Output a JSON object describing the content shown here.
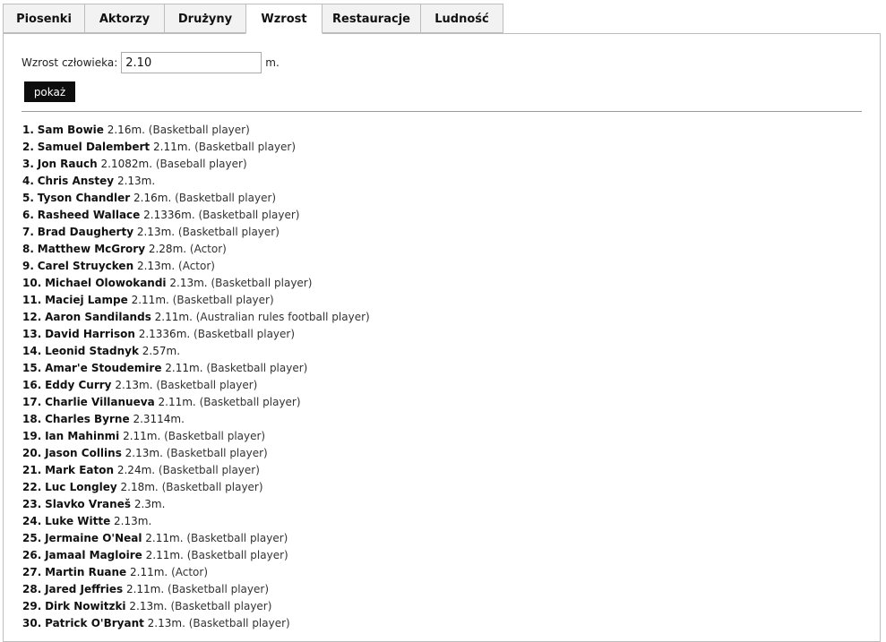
{
  "tabs": [
    {
      "label": "Piosenki",
      "active": false
    },
    {
      "label": "Aktorzy",
      "active": false
    },
    {
      "label": "Drużyny",
      "active": false
    },
    {
      "label": "Wzrost",
      "active": true
    },
    {
      "label": "Restauracje",
      "active": false
    },
    {
      "label": "Ludność",
      "active": false
    }
  ],
  "form": {
    "label": "Wzrost człowieka:",
    "value": "2.10",
    "unit": "m.",
    "button": "pokaż"
  },
  "results": [
    {
      "num": "1.",
      "name": "Sam Bowie",
      "height": "2.16m.",
      "role": "(Basketball player)"
    },
    {
      "num": "2.",
      "name": "Samuel Dalembert",
      "height": "2.11m.",
      "role": "(Basketball player)"
    },
    {
      "num": "3.",
      "name": "Jon Rauch",
      "height": "2.1082m.",
      "role": "(Baseball player)"
    },
    {
      "num": "4.",
      "name": "Chris Anstey",
      "height": "2.13m.",
      "role": ""
    },
    {
      "num": "5.",
      "name": "Tyson Chandler",
      "height": "2.16m.",
      "role": "(Basketball player)"
    },
    {
      "num": "6.",
      "name": "Rasheed Wallace",
      "height": "2.1336m.",
      "role": "(Basketball player)"
    },
    {
      "num": "7.",
      "name": "Brad Daugherty",
      "height": "2.13m.",
      "role": "(Basketball player)"
    },
    {
      "num": "8.",
      "name": "Matthew McGrory",
      "height": "2.28m.",
      "role": "(Actor)"
    },
    {
      "num": "9.",
      "name": "Carel Struycken",
      "height": "2.13m.",
      "role": "(Actor)"
    },
    {
      "num": "10.",
      "name": "Michael Olowokandi",
      "height": "2.13m.",
      "role": "(Basketball player)"
    },
    {
      "num": "11.",
      "name": "Maciej Lampe",
      "height": "2.11m.",
      "role": "(Basketball player)"
    },
    {
      "num": "12.",
      "name": "Aaron Sandilands",
      "height": "2.11m.",
      "role": "(Australian rules football player)"
    },
    {
      "num": "13.",
      "name": "David Harrison",
      "height": "2.1336m.",
      "role": "(Basketball player)"
    },
    {
      "num": "14.",
      "name": "Leonid Stadnyk",
      "height": "2.57m.",
      "role": ""
    },
    {
      "num": "15.",
      "name": "Amar'e Stoudemire",
      "height": "2.11m.",
      "role": "(Basketball player)"
    },
    {
      "num": "16.",
      "name": "Eddy Curry",
      "height": "2.13m.",
      "role": "(Basketball player)"
    },
    {
      "num": "17.",
      "name": "Charlie Villanueva",
      "height": "2.11m.",
      "role": "(Basketball player)"
    },
    {
      "num": "18.",
      "name": "Charles Byrne",
      "height": "2.3114m.",
      "role": ""
    },
    {
      "num": "19.",
      "name": "Ian Mahinmi",
      "height": "2.11m.",
      "role": "(Basketball player)"
    },
    {
      "num": "20.",
      "name": "Jason Collins",
      "height": "2.13m.",
      "role": "(Basketball player)"
    },
    {
      "num": "21.",
      "name": "Mark Eaton",
      "height": "2.24m.",
      "role": "(Basketball player)"
    },
    {
      "num": "22.",
      "name": "Luc Longley",
      "height": "2.18m.",
      "role": "(Basketball player)"
    },
    {
      "num": "23.",
      "name": "Slavko Vraneš",
      "height": "2.3m.",
      "role": ""
    },
    {
      "num": "24.",
      "name": "Luke Witte",
      "height": "2.13m.",
      "role": ""
    },
    {
      "num": "25.",
      "name": "Jermaine O'Neal",
      "height": "2.11m.",
      "role": "(Basketball player)"
    },
    {
      "num": "26.",
      "name": "Jamaal Magloire",
      "height": "2.11m.",
      "role": "(Basketball player)"
    },
    {
      "num": "27.",
      "name": "Martin Ruane",
      "height": "2.11m.",
      "role": "(Actor)"
    },
    {
      "num": "28.",
      "name": "Jared Jeffries",
      "height": "2.11m.",
      "role": "(Basketball player)"
    },
    {
      "num": "29.",
      "name": "Dirk Nowitzki",
      "height": "2.13m.",
      "role": "(Basketball player)"
    },
    {
      "num": "30.",
      "name": "Patrick O'Bryant",
      "height": "2.13m.",
      "role": "(Basketball player)"
    }
  ]
}
